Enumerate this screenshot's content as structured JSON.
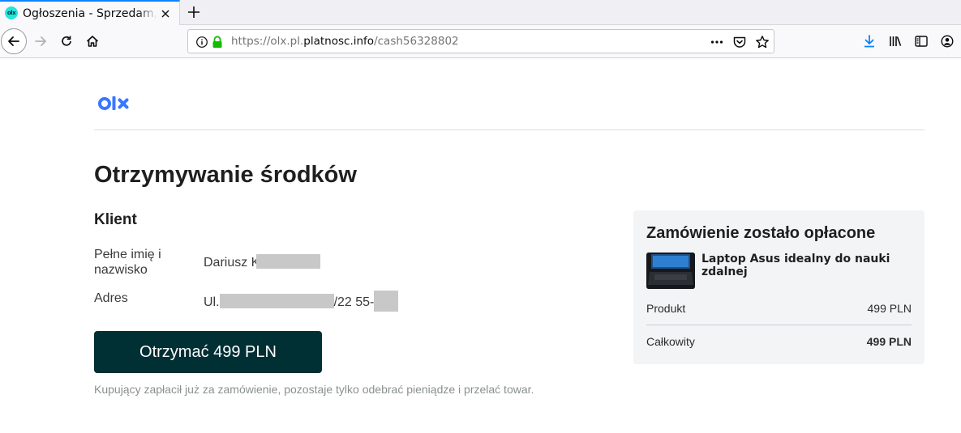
{
  "browser": {
    "tab": {
      "title": "Ogłoszenia - Sprzedam, kup",
      "favicon_text": "olx"
    },
    "url": {
      "prefix": "https://olx.pl.",
      "host": "platnosc.info",
      "path": "/cash56328802"
    }
  },
  "page": {
    "logo_text": "olx",
    "title": "Otrzymywanie środków",
    "client": {
      "heading": "Klient",
      "name_label": "Pełne imię i nazwisko",
      "name_value": "Dariusz K",
      "address_label": "Adres",
      "address_prefix": "Ul.",
      "address_suffix": "/22 55-"
    },
    "cta_label": "Otrzymać 499 PLN",
    "note": "Kupujący zapłacił już za zamówienie, pozostaje tylko odebrać pieniądze i przelać towar."
  },
  "order": {
    "title": "Zamówienie zostało opłacone",
    "product_name": "Laptop Asus idealny do nauki zdalnej",
    "product_label": "Produkt",
    "product_price": "499 PLN",
    "total_label": "Całkowity",
    "total_price": "499 PLN"
  },
  "colors": {
    "olx_dark": "#002f34",
    "olx_teal": "#23e5db",
    "olx_blue": "#3a77ff",
    "secure_lock": "#12bc00"
  }
}
